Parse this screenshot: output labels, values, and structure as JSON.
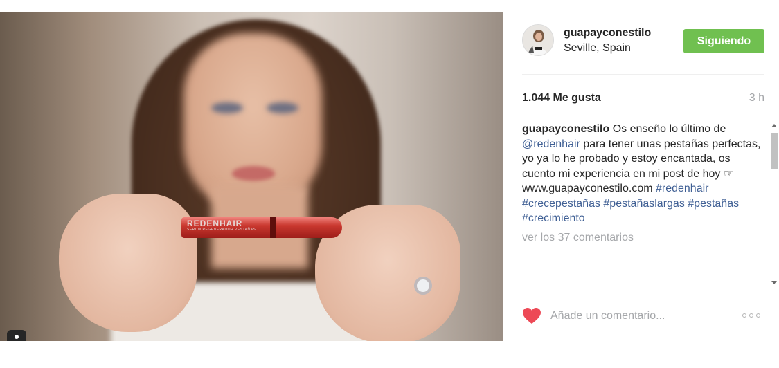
{
  "post": {
    "image": {
      "brand_text": "REDENHAIR",
      "product_sub_text": "SERUM REGENERADOR PESTAÑAS"
    },
    "user": {
      "username": "guapayconestilo",
      "location": "Seville, Spain"
    },
    "follow_label": "Siguiendo",
    "likes_text": "1.044 Me gusta",
    "time_ago": "3 h",
    "caption": {
      "author": "guapayconestilo",
      "text_1": " Os enseño lo último de ",
      "mention": "@redenhair",
      "text_2": " para tener unas pestañas perfectas, yo ya lo he probado y estoy encantada, os cuento mi experiencia en mi post de hoy ☞ www.guapayconestilo.com ",
      "hashtags": "#redenhair #crecepestañas #pestañaslargas #pestañas #crecimiento"
    },
    "view_comments_label": "ver los 37 comentarios",
    "comment_placeholder": "Añade un comentario...",
    "colors": {
      "follow_green": "#70c050",
      "link_blue": "#3f5f94",
      "heart_red": "#ed4956",
      "muted_gray": "#a5a7aa"
    },
    "icons": {
      "tag": "user-tag-icon",
      "like": "heart-icon",
      "more": "more-options-icon"
    }
  }
}
